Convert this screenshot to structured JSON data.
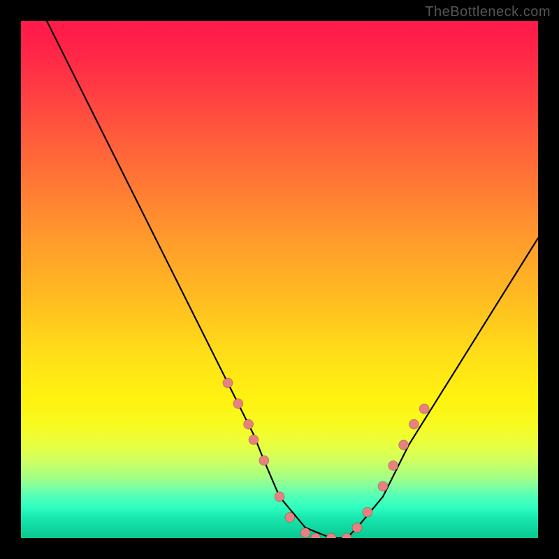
{
  "watermark": "TheBottleneck.com",
  "chart_data": {
    "type": "line",
    "title": "",
    "xlabel": "",
    "ylabel": "",
    "xlim": [
      0,
      100
    ],
    "ylim": [
      0,
      100
    ],
    "series": [
      {
        "name": "curve",
        "x": [
          5,
          10,
          15,
          20,
          25,
          30,
          35,
          40,
          45,
          47,
          50,
          55,
          60,
          63,
          65,
          70,
          75,
          80,
          85,
          90,
          95,
          100
        ],
        "y": [
          100,
          90,
          80,
          70,
          60,
          50,
          40,
          30,
          20,
          15,
          8,
          2,
          0,
          0,
          2,
          8,
          18,
          26,
          34,
          42,
          50,
          58
        ]
      }
    ],
    "markers": {
      "color": "#e88080",
      "points": [
        {
          "x": 40,
          "y": 30
        },
        {
          "x": 42,
          "y": 26
        },
        {
          "x": 44,
          "y": 22
        },
        {
          "x": 45,
          "y": 19
        },
        {
          "x": 47,
          "y": 15
        },
        {
          "x": 50,
          "y": 8
        },
        {
          "x": 52,
          "y": 4
        },
        {
          "x": 55,
          "y": 1
        },
        {
          "x": 57,
          "y": 0
        },
        {
          "x": 60,
          "y": 0
        },
        {
          "x": 63,
          "y": 0
        },
        {
          "x": 65,
          "y": 2
        },
        {
          "x": 67,
          "y": 5
        },
        {
          "x": 70,
          "y": 10
        },
        {
          "x": 72,
          "y": 14
        },
        {
          "x": 74,
          "y": 18
        },
        {
          "x": 76,
          "y": 22
        },
        {
          "x": 78,
          "y": 25
        }
      ]
    },
    "gradient_stops": [
      {
        "pos": 0,
        "color": "#ff1a4a"
      },
      {
        "pos": 50,
        "color": "#ffc020"
      },
      {
        "pos": 75,
        "color": "#fff210"
      },
      {
        "pos": 100,
        "color": "#0ac890"
      }
    ],
    "grid": false,
    "legend": false
  }
}
